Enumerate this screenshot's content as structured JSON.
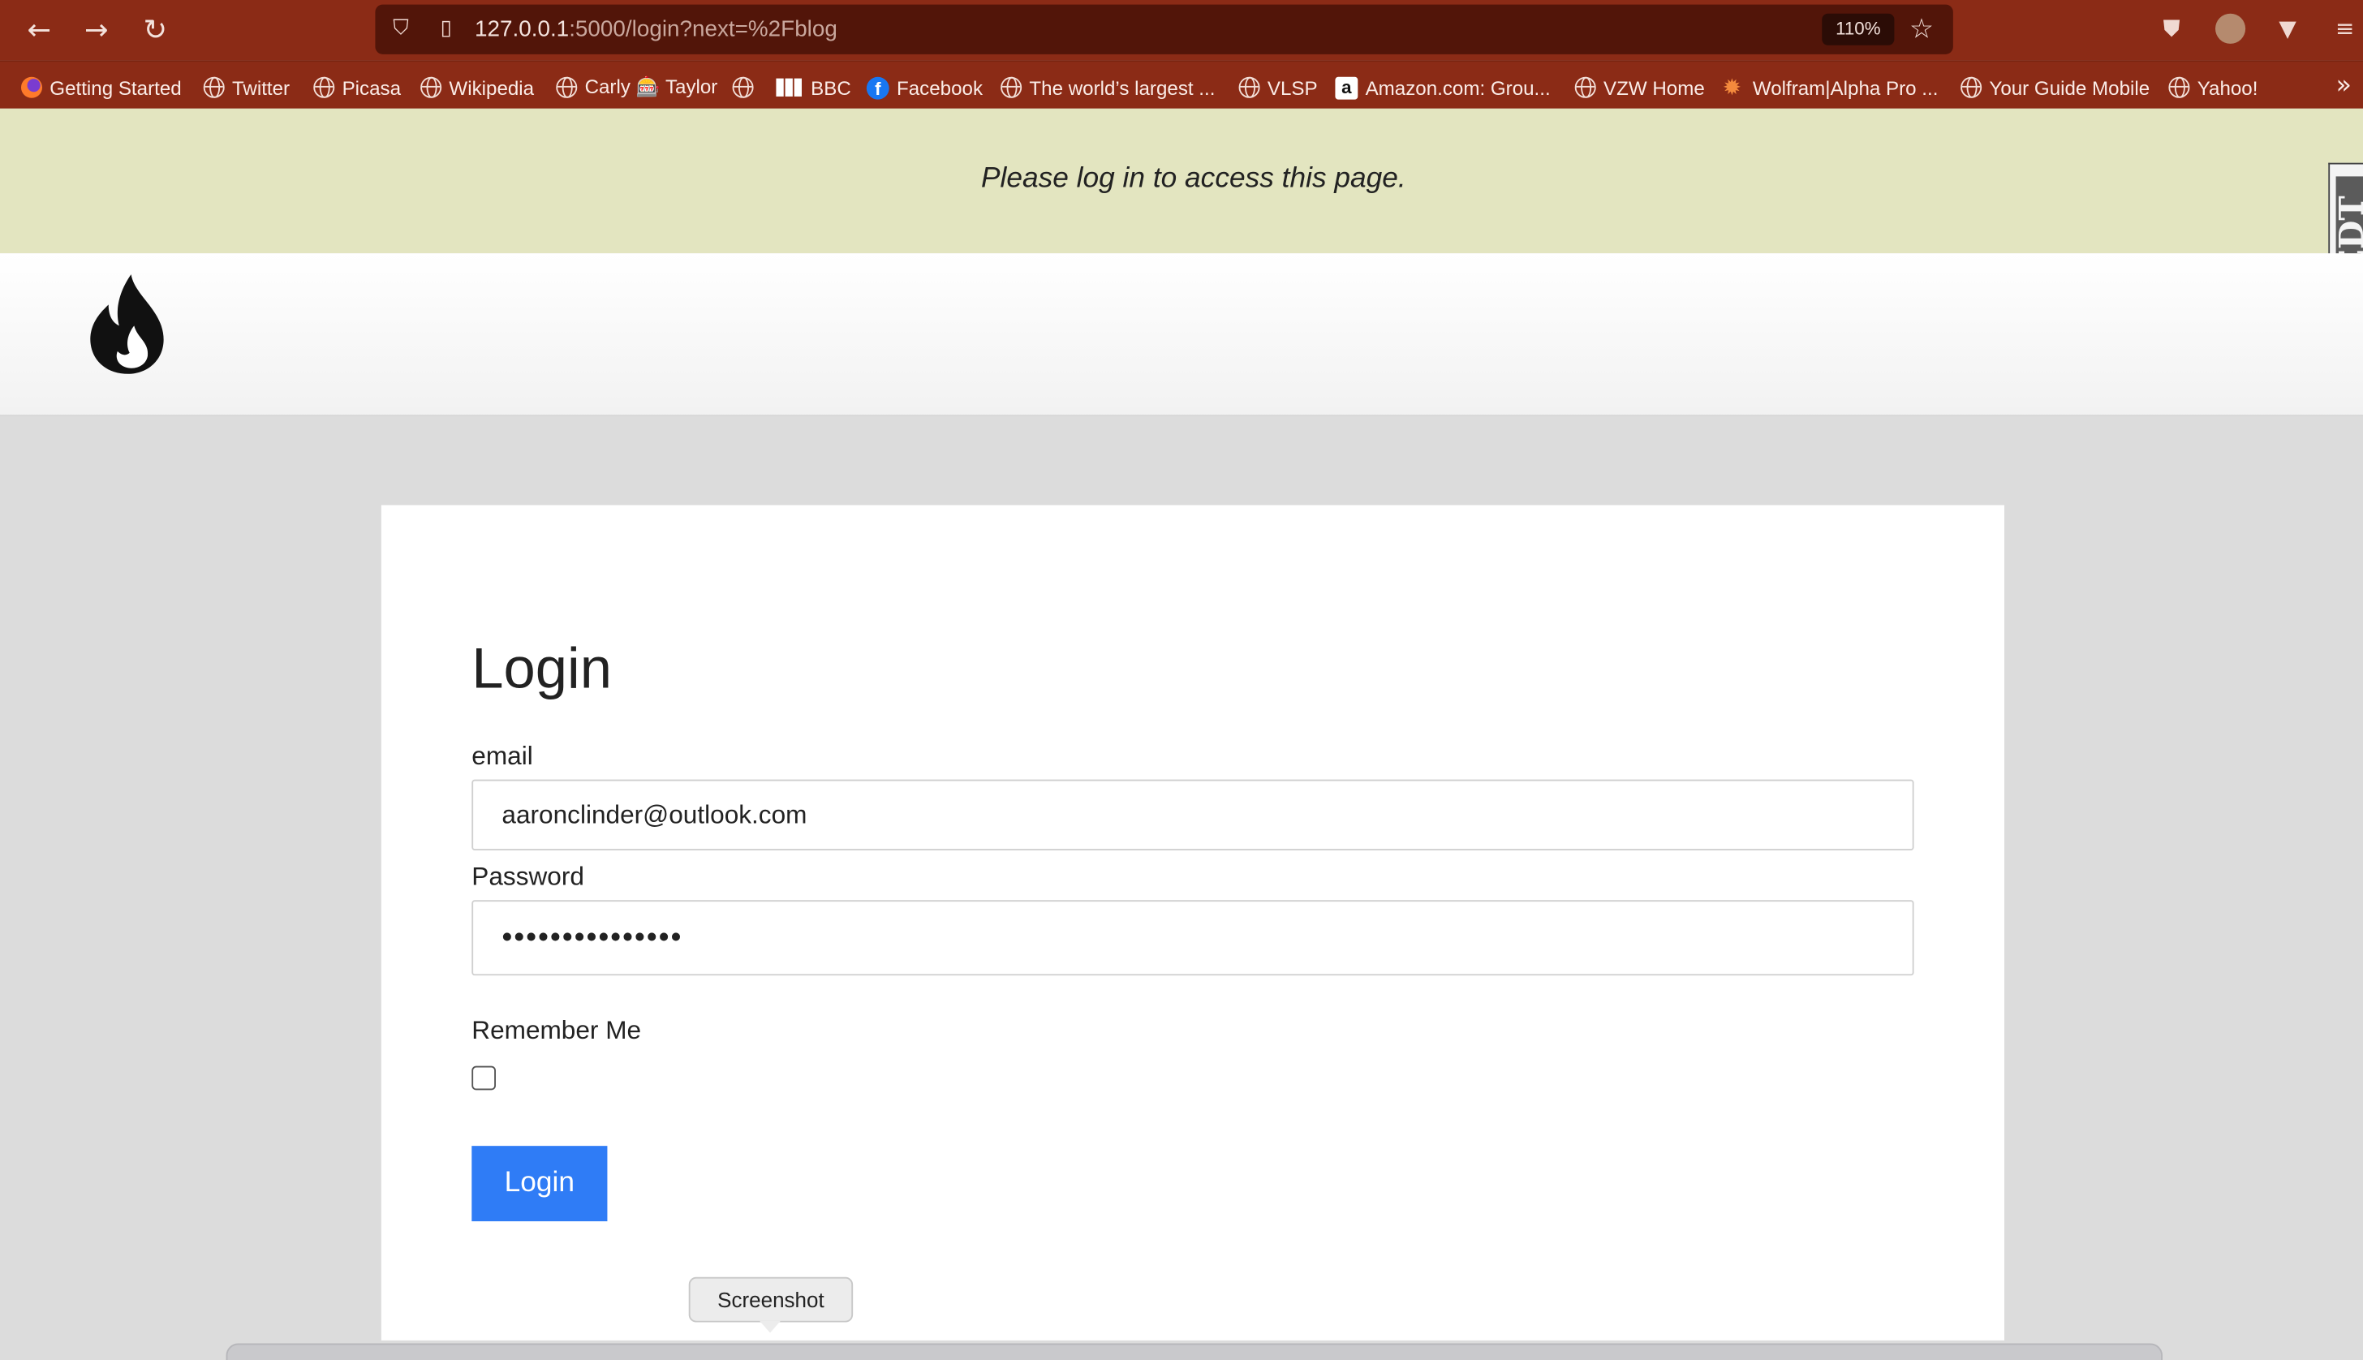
{
  "browser": {
    "url_host": "127.0.0.1",
    "url_rest": ":5000/login?next=%2Fblog",
    "zoom": "110%",
    "bookmarks": [
      {
        "label": "Getting Started",
        "icon": "firefox-icon"
      },
      {
        "label": "Twitter",
        "icon": "globe-icon"
      },
      {
        "label": "Picasa",
        "icon": "globe-icon"
      },
      {
        "label": "Wikipedia",
        "icon": "globe-icon"
      },
      {
        "label": "Carly 🎰 Taylor",
        "icon": "globe-icon"
      },
      {
        "label": "",
        "icon": "globe-icon"
      },
      {
        "label": "BBC",
        "icon": "bbc-icon"
      },
      {
        "label": "Facebook",
        "icon": "facebook-icon"
      },
      {
        "label": "The world’s largest ...",
        "icon": "globe-icon"
      },
      {
        "label": "VLSP",
        "icon": "globe-icon"
      },
      {
        "label": "Amazon.com: Grou...",
        "icon": "amazon-icon"
      },
      {
        "label": "VZW Home",
        "icon": "globe-icon"
      },
      {
        "label": "Wolfram|Alpha Pro ...",
        "icon": "wolfram-icon"
      },
      {
        "label": "Your Guide Mobile",
        "icon": "globe-icon"
      },
      {
        "label": "Yahoo!",
        "icon": "globe-icon"
      }
    ]
  },
  "flash": {
    "message": "Please log in to access this page."
  },
  "login": {
    "title": "Login",
    "email_label": "email",
    "email_value": "aaronclinder@outlook.com",
    "password_label": "Password",
    "password_value": "•••••••••••••••",
    "remember_label": "Remember Me",
    "remember_checked": false,
    "submit_label": "Login"
  },
  "tooltip": {
    "text": "Screenshot"
  },
  "colors": {
    "toolbar": "#8b2b16",
    "urlbar": "#521509",
    "flash_bg": "#e3e5c0",
    "button": "#2f7cf6"
  }
}
